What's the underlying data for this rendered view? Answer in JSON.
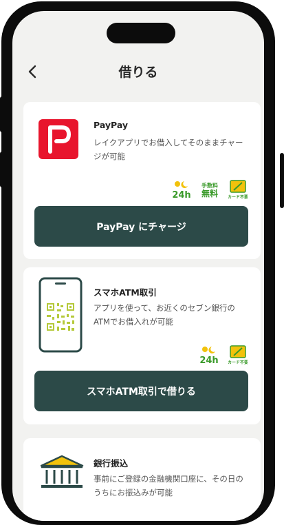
{
  "header": {
    "title": "借りる"
  },
  "cards": [
    {
      "title": "PayPay",
      "description": "レイクアプリでお借入してそのままチャージが可能",
      "button": "PayPay にチャージ"
    },
    {
      "title": "スマホATM取引",
      "description": "アプリを使って、お近くのセブン銀行のATMでお借入れが可能",
      "button": "スマホATM取引で借りる"
    },
    {
      "title": "銀行振込",
      "description": "事前にご登録の金融機関口座に、その日のうちにお振込みが可能"
    }
  ],
  "badges": {
    "hours": "24h",
    "no_fee": "手数料無料",
    "no_card": "カード不要"
  },
  "colors": {
    "primary": "#2c4a48",
    "paypay_red": "#e8152d",
    "badge_green": "#3a9a2a",
    "qr_lime": "#b5c93a",
    "background": "#f2f2f0"
  }
}
